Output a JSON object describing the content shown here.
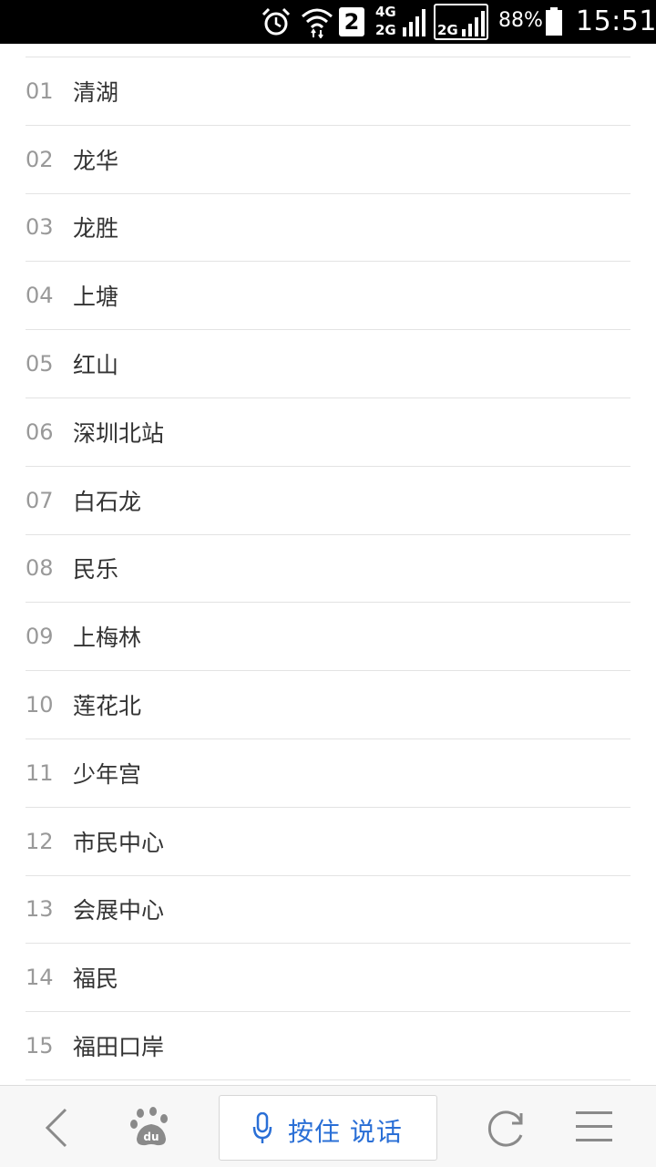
{
  "status_bar": {
    "sim_slot": "2",
    "network_top": "4G",
    "network_bottom": "2G",
    "network_second": "2G",
    "battery_percent": "88%",
    "time": "15:51"
  },
  "stations": [
    {
      "num": "01",
      "name": "清湖"
    },
    {
      "num": "02",
      "name": "龙华"
    },
    {
      "num": "03",
      "name": "龙胜"
    },
    {
      "num": "04",
      "name": "上塘"
    },
    {
      "num": "05",
      "name": "红山"
    },
    {
      "num": "06",
      "name": "深圳北站"
    },
    {
      "num": "07",
      "name": "白石龙"
    },
    {
      "num": "08",
      "name": "民乐"
    },
    {
      "num": "09",
      "name": "上梅林"
    },
    {
      "num": "10",
      "name": "莲花北"
    },
    {
      "num": "11",
      "name": "少年宫"
    },
    {
      "num": "12",
      "name": "市民中心"
    },
    {
      "num": "13",
      "name": "会展中心"
    },
    {
      "num": "14",
      "name": "福民"
    },
    {
      "num": "15",
      "name": "福田口岸"
    }
  ],
  "bottom_bar": {
    "back_icon": "back-icon",
    "home_icon": "baidu-paw-icon",
    "voice_label": "按住 说话",
    "mic_icon": "microphone-icon",
    "refresh_icon": "refresh-icon",
    "menu_icon": "menu-icon"
  },
  "colors": {
    "accent": "#2a6fd6",
    "number_gray": "#999999",
    "divider": "#e3e3e3"
  }
}
